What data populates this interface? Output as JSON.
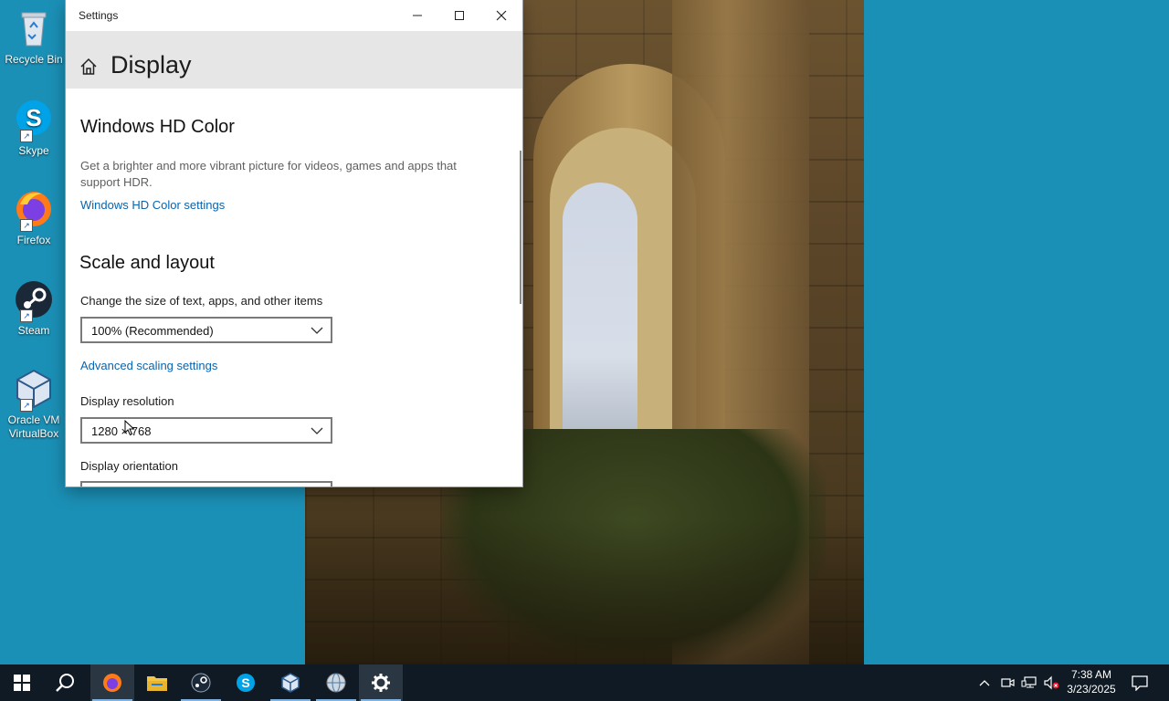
{
  "desktop": {
    "icons": [
      {
        "label": "Recycle Bin",
        "icon": "recycle-bin-icon"
      },
      {
        "label": "Skype",
        "icon": "skype-icon"
      },
      {
        "label": "Firefox",
        "icon": "firefox-icon"
      },
      {
        "label": "Steam",
        "icon": "steam-icon"
      },
      {
        "label": "Oracle VM VirtualBox",
        "icon": "virtualbox-icon"
      }
    ]
  },
  "window": {
    "title": "Settings",
    "page_title": "Display"
  },
  "hdr": {
    "heading": "Windows HD Color",
    "description": "Get a brighter and more vibrant picture for videos, games and apps that support HDR.",
    "link": "Windows HD Color settings"
  },
  "scale": {
    "heading": "Scale and layout",
    "size_label": "Change the size of text, apps, and other items",
    "size_value": "100% (Recommended)",
    "advanced_link": "Advanced scaling settings",
    "resolution_label": "Display resolution",
    "resolution_value": "1280 × 768",
    "orientation_label": "Display orientation"
  },
  "taskbar": {
    "apps": [
      "start-icon",
      "search-icon",
      "firefox-icon",
      "file-explorer-icon",
      "steam-icon",
      "skype-icon",
      "virtualbox-icon",
      "network-globe-icon",
      "settings-gear-icon"
    ],
    "clock_time": "7:38 AM",
    "clock_date": "3/23/2025"
  },
  "colors": {
    "accent": "#0a64ad",
    "desktop": "#1b90b6",
    "taskbar": "#0f1a24"
  }
}
